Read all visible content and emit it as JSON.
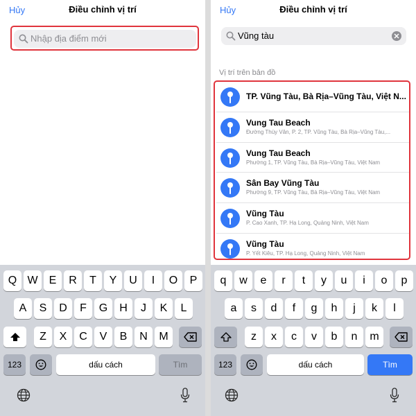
{
  "left": {
    "nav": {
      "cancel": "Hủy",
      "title": "Điều chỉnh vị trí"
    },
    "search": {
      "placeholder": "Nhập địa điểm mới"
    },
    "keyboard": {
      "row1": [
        "Q",
        "W",
        "E",
        "R",
        "T",
        "Y",
        "U",
        "I",
        "O",
        "P"
      ],
      "row2": [
        "A",
        "S",
        "D",
        "F",
        "G",
        "H",
        "J",
        "K",
        "L"
      ],
      "row3": [
        "Z",
        "X",
        "C",
        "V",
        "B",
        "N",
        "M"
      ],
      "numbers": "123",
      "space": "dấu cách",
      "action": "Tìm"
    }
  },
  "right": {
    "nav": {
      "cancel": "Hủy",
      "title": "Điều chỉnh vị trí"
    },
    "search": {
      "value": "Vũng tàu"
    },
    "section_label": "Vị trí trên bản đồ",
    "results": [
      {
        "title": "TP. Vũng Tàu, Bà Rịa–Vũng Tàu, Việt N...",
        "subtitle": ""
      },
      {
        "title": "Vung Tau Beach",
        "subtitle": "Đường Thùy Vân, P. 2, TP. Vũng Tàu, Bà Rịa–Vũng Tàu,..."
      },
      {
        "title": "Vung Tau Beach",
        "subtitle": "Phường 1, TP. Vũng Tàu, Bà Rịa–Vũng Tàu, Việt Nam"
      },
      {
        "title": "Sân Bay Vũng Tàu",
        "subtitle": "Phường 9, TP. Vũng Tàu, Bà Rịa–Vũng Tàu, Việt Nam"
      },
      {
        "title": "Vũng Tàu",
        "subtitle": "P. Cao Xanh, TP. Hạ Long, Quảng Ninh, Việt Nam"
      },
      {
        "title": "Vũng Tàu",
        "subtitle": "P. Yết Kiêu, TP. Hạ Long, Quảng Ninh, Việt Nam"
      }
    ],
    "keyboard": {
      "row1": [
        "q",
        "w",
        "e",
        "r",
        "t",
        "y",
        "u",
        "i",
        "o",
        "p"
      ],
      "row2": [
        "a",
        "s",
        "d",
        "f",
        "g",
        "h",
        "j",
        "k",
        "l"
      ],
      "row3": [
        "z",
        "x",
        "c",
        "v",
        "b",
        "n",
        "m"
      ],
      "numbers": "123",
      "space": "dấu cách",
      "action": "Tìm"
    }
  },
  "colors": {
    "accent": "#3478f6",
    "highlight": "#e0343c",
    "keyboard_bg": "#d2d5db"
  },
  "icons": [
    "search-icon",
    "clear-icon",
    "map-pin-icon",
    "shift-icon",
    "backspace-icon",
    "emoji-icon",
    "globe-icon",
    "microphone-icon"
  ]
}
